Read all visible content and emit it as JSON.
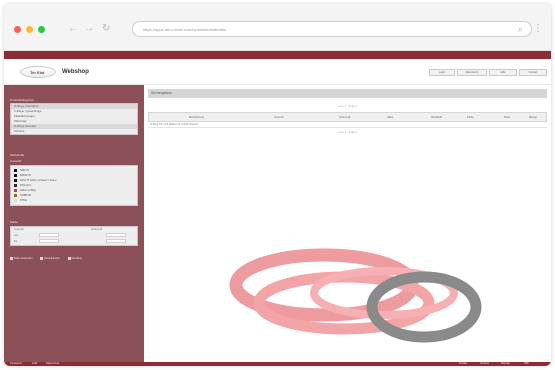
{
  "browser": {
    "url": "https://apps.aero-elast.com/hz/ersatz/materials",
    "nav_back": "←",
    "nav_forward": "→",
    "nav_reload": "↻",
    "search_glyph": "⌕",
    "menu_glyph": "⋮"
  },
  "header": {
    "logo_text": "Ter Elst",
    "site_title": "Webshop",
    "buttons": [
      "Login",
      "Warenkorb",
      "Hilfe",
      "Kontakt"
    ]
  },
  "sidebar": {
    "nav_title": "Produktkategorien",
    "nav_items": [
      {
        "label": "O-Ringe (Standard)",
        "selected": true
      },
      {
        "label": "X-Ringe / Quad-Ringe",
        "selected": false
      },
      {
        "label": "Flachdichtungen",
        "selected": false
      },
      {
        "label": "Stützringe",
        "selected": false
      },
      {
        "label": "O-Ringe (Sonder)",
        "selected": true
      },
      {
        "label": "Schnüre",
        "selected": false
      }
    ],
    "material_title": "Werkstoffe",
    "material_subtitle": "Auswahl",
    "categories": [
      {
        "label": "NBR 70",
        "color": "#111111"
      },
      {
        "label": "EPDM 70",
        "color": "#111111"
      },
      {
        "label": "FKM 75 (Viton) schwarz / braun",
        "color": "#111111"
      },
      {
        "label": "FKM grün",
        "color": "#2a2a2a"
      },
      {
        "label": "Silikon (VMQ)",
        "color": "#b04848"
      },
      {
        "label": "HNBR 80",
        "color": "#8a6a2a"
      },
      {
        "label": "PTFE",
        "color": "#dddddd"
      }
    ],
    "filter_title": "Maße",
    "filter_labels": [
      "Innen-Ø",
      "Schnur-Ø",
      "von",
      "bis"
    ],
    "links": [
      "Filter anwenden",
      "Zurücksetzen",
      "Merkliste"
    ]
  },
  "main": {
    "title": "Suchergebnis",
    "pager_top": "« 1 »  1 - 1 von 1",
    "pager_bottom": "« 1 »  1 - 1 von 1",
    "columns": [
      "Bezeichnung",
      "Innen-Ø",
      "Schnur-Ø",
      "Härte",
      "Werkstoff",
      "Farbe",
      "Preis",
      "Menge"
    ],
    "row": "O-Ring 15 x 2,5 Silikon rot / FKM schwarz"
  },
  "product_image": {
    "icon": "o-ring-photo",
    "colors": {
      "red": "#e04a52",
      "black": "#2b2b2b"
    }
  },
  "footer": {
    "left_items": [
      "Impressum",
      "AGB",
      "Datenschutz"
    ],
    "right_items": [
      "Kontakt",
      "Versand",
      "Sitemap",
      "Hilfe"
    ]
  },
  "colors": {
    "brand": "#8b2c35",
    "sidebar": "#8b5058"
  }
}
